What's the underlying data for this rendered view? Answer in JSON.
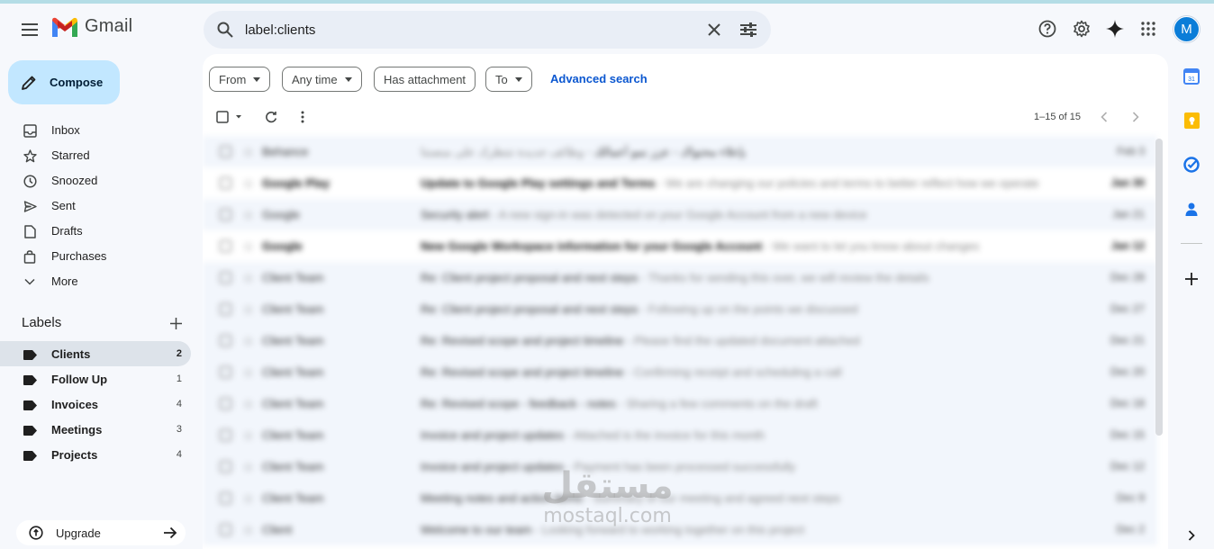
{
  "app": {
    "name": "Gmail"
  },
  "header": {
    "search_value": "label:clients",
    "avatar_letter": "M"
  },
  "nav": {
    "compose_label": "Compose",
    "items": [
      {
        "label": "Inbox",
        "icon": "inbox-icon"
      },
      {
        "label": "Starred",
        "icon": "star-icon"
      },
      {
        "label": "Snoozed",
        "icon": "clock-icon"
      },
      {
        "label": "Sent",
        "icon": "send-icon"
      },
      {
        "label": "Drafts",
        "icon": "draft-icon"
      },
      {
        "label": "Purchases",
        "icon": "bag-icon"
      },
      {
        "label": "More",
        "icon": "chevron-down-icon"
      }
    ],
    "labels_title": "Labels",
    "labels": [
      {
        "label": "Clients",
        "count": "2",
        "active": true
      },
      {
        "label": "Follow Up",
        "count": "1"
      },
      {
        "label": "Invoices",
        "count": "4"
      },
      {
        "label": "Meetings",
        "count": "3"
      },
      {
        "label": "Projects",
        "count": "4"
      }
    ],
    "upgrade_label": "Upgrade"
  },
  "filters": {
    "chips": [
      "From",
      "Any time",
      "Has attachment",
      "To"
    ],
    "advanced": "Advanced search"
  },
  "toolbar": {
    "pagination": "1–15 of 15"
  },
  "emails": [
    {
      "sender": "Behance",
      "subject": "بإعلاء محتواك - عزز نمو أعمالك",
      "snippet": " - وظائف جديدة تنتظرك على منصتنا",
      "date": "Feb 3",
      "unread": false
    },
    {
      "sender": "Google Play",
      "subject": "Update to Google Play settings and Terms",
      "snippet": " - We are changing our policies and terms to better reflect how we operate",
      "date": "Jan 30",
      "unread": true
    },
    {
      "sender": "Google",
      "subject": "Security alert",
      "snippet": " - A new sign-in was detected on your Google Account from a new device",
      "date": "Jan 21",
      "unread": false
    },
    {
      "sender": "Google",
      "subject": "New Google Workspace information for your Google Account",
      "snippet": " - We want to let you know about changes",
      "date": "Jan 12",
      "unread": true
    },
    {
      "sender": "Client Team",
      "subject": "Re: Client project proposal and next steps",
      "snippet": " - Thanks for sending this over, we will review the details",
      "date": "Dec 28",
      "unread": false
    },
    {
      "sender": "Client Team",
      "subject": "Re: Client project proposal and next steps",
      "snippet": " - Following up on the points we discussed",
      "date": "Dec 27",
      "unread": false
    },
    {
      "sender": "Client Team",
      "subject": "Re: Revised scope and project timeline",
      "snippet": " - Please find the updated document attached",
      "date": "Dec 21",
      "unread": false
    },
    {
      "sender": "Client Team",
      "subject": "Re: Revised scope and project timeline",
      "snippet": " - Confirming receipt and scheduling a call",
      "date": "Dec 20",
      "unread": false
    },
    {
      "sender": "Client Team",
      "subject": "Re: Revised scope - feedback - notes",
      "snippet": " - Sharing a few comments on the draft",
      "date": "Dec 18",
      "unread": false
    },
    {
      "sender": "Client Team",
      "subject": "Invoice and project updates",
      "snippet": " - Attached is the invoice for this month",
      "date": "Dec 15",
      "unread": false
    },
    {
      "sender": "Client Team",
      "subject": "Invoice and project updates",
      "snippet": " - Payment has been processed successfully",
      "date": "Dec 12",
      "unread": false
    },
    {
      "sender": "Client Team",
      "subject": "Meeting notes and action items",
      "snippet": " - Summary of our meeting and agreed next steps",
      "date": "Dec 9",
      "unread": false
    },
    {
      "sender": "Client",
      "subject": "Welcome to our team",
      "snippet": " - Looking forward to working together on this project",
      "date": "Dec 2",
      "unread": false
    }
  ],
  "watermark": {
    "arabic": "مستقل",
    "latin": "mostaql.com"
  }
}
